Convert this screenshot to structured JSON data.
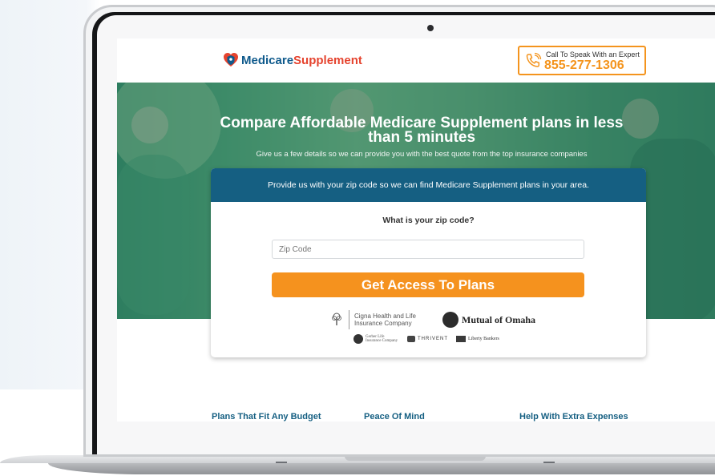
{
  "brand": {
    "name_part1": "Medicare",
    "name_part2": "Supplement"
  },
  "call": {
    "label": "Call To Speak With an Expert",
    "number": "855-277-1306"
  },
  "hero": {
    "title": "Compare Affordable Medicare Supplement plans in less than 5 minutes",
    "subtitle": "Give us a few details so we can provide you with the best quote from the top insurance companies"
  },
  "form": {
    "header": "Provide us with your zip code so we can find Medicare Supplement plans in your area.",
    "question": "What is your zip code?",
    "zip_placeholder": "Zip Code",
    "cta": "Get Access To Plans"
  },
  "partners": {
    "cigna": "Cigna Health and Life Insurance Company",
    "mutual": "Mutual of Omaha",
    "gerber": "Gerber Life Insurance Company",
    "thrivent": "THRIVENT",
    "liberty": "Liberty Bankers"
  },
  "features": [
    "Plans That Fit Any Budget",
    "Peace Of Mind",
    "Help With Extra Expenses"
  ],
  "colors": {
    "brand_blue": "#0f5a8c",
    "brand_red": "#e5432e",
    "accent_orange": "#f5921e",
    "card_header": "#155f82"
  }
}
